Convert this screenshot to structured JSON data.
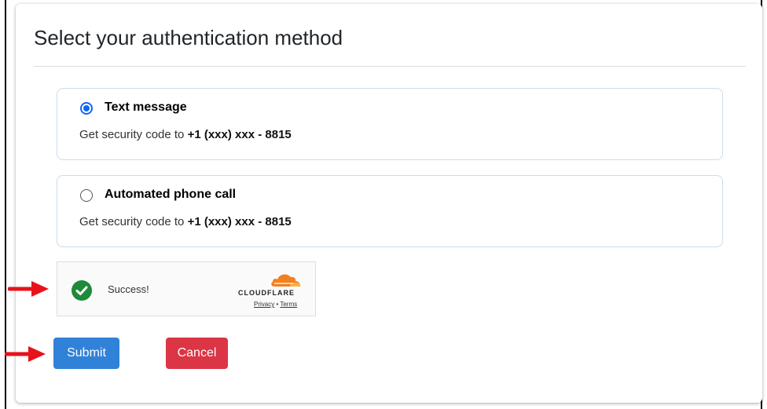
{
  "page": {
    "title": "Select your authentication method"
  },
  "options": [
    {
      "label": "Text message",
      "desc_prefix": "Get security code to ",
      "desc_value": "+1 (xxx) xxx - 8815",
      "selected": true
    },
    {
      "label": "Automated phone call",
      "desc_prefix": "Get security code to ",
      "desc_value": "+1 (xxx) xxx - 8815",
      "selected": false
    }
  ],
  "captcha": {
    "status": "Success!",
    "brand": "CLOUDFLARE",
    "privacy": "Privacy",
    "separator": "•",
    "terms": "Terms",
    "status_icon": "check-circle-icon",
    "status_color": "#1e8a3a",
    "brand_color": "#f38020"
  },
  "actions": {
    "submit": "Submit",
    "cancel": "Cancel",
    "submit_color": "#3081d8",
    "cancel_color": "#dc3545"
  },
  "annotations": {
    "arrow_color": "#e8121b",
    "arrow_icon": "red-arrow-right-icon"
  }
}
